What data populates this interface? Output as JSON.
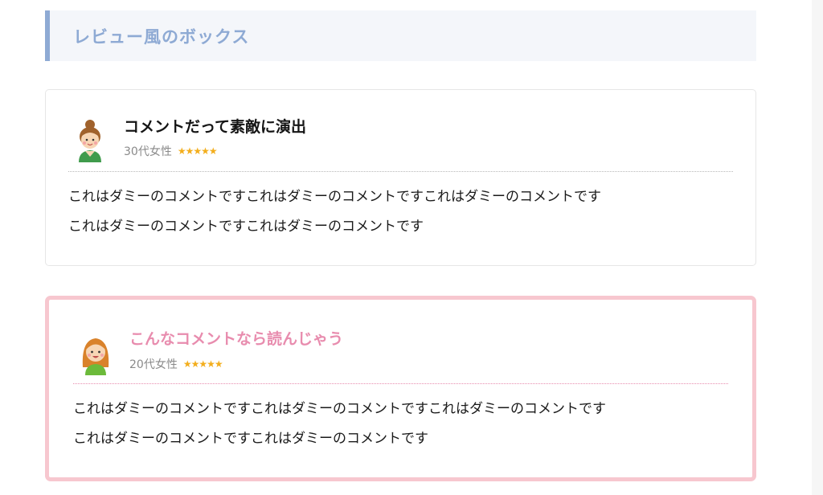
{
  "section": {
    "heading": "レビュー風のボックス"
  },
  "reviews": [
    {
      "avatar_icon": "woman-bun-avatar-icon",
      "title": "コメントだって素敵に演出",
      "reviewer": "30代女性",
      "rating": 5,
      "stars": "★★★★★",
      "body_lines": [
        "これはダミーのコメントですこれはダミーのコメントですこれはダミーのコメントです",
        "これはダミーのコメントですこれはダミーのコメントです"
      ]
    },
    {
      "avatar_icon": "girl-long-hair-avatar-icon",
      "title": "こんなコメントなら読んじゃう",
      "reviewer": "20代女性",
      "rating": 5,
      "stars": "★★★★★",
      "body_lines": [
        "これはダミーのコメントですこれはダミーのコメントですこれはダミーのコメントです",
        "これはダミーのコメントですこれはダミーのコメントです"
      ]
    }
  ],
  "colors": {
    "heading_accent": "#8eaad4",
    "heading_bg": "#f4f6fa",
    "pink_border": "#f7c7cf",
    "pink_title": "#e88cae",
    "star": "#f3ae1d"
  }
}
